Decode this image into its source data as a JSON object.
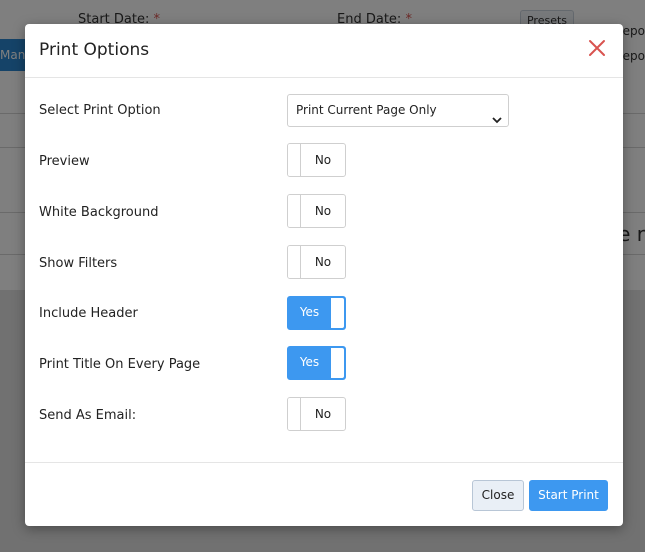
{
  "background": {
    "start_date_label": "Start Date:",
    "end_date_label": "End Date:",
    "required_mark": "*",
    "presets_label": "Presets",
    "tab_label": "Mana",
    "side_text_1": "Repo",
    "side_text_2": "Repo",
    "big_text": "e r"
  },
  "modal": {
    "title": "Print Options",
    "close_icon": "close-x-icon",
    "rows": {
      "select_label": "Select Print Option",
      "preview_label": "Preview",
      "white_bg_label": "White Background",
      "show_filters_label": "Show Filters",
      "include_header_label": "Include Header",
      "print_title_label": "Print Title On Every Page",
      "send_email_label": "Send As Email:"
    },
    "select_value": "Print Current Page Only",
    "toggles": {
      "preview": "No",
      "white_bg": "No",
      "show_filters": "No",
      "include_header": "Yes",
      "print_title": "Yes",
      "send_email": "No"
    },
    "buttons": {
      "close": "Close",
      "start_print": "Start Print"
    }
  },
  "colors": {
    "accent": "#3d98f0",
    "close_x": "#d9534f",
    "overlay": "rgba(0,0,0,0.5)"
  }
}
